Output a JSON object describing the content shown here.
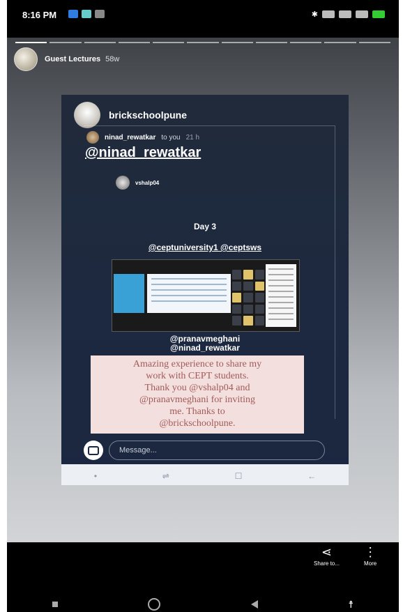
{
  "status_bar": {
    "time": "8:16 PM",
    "right_text": "* ▭ ▭ ▭ ▭ #"
  },
  "story_header": {
    "account": "Guest Lectures",
    "age": "58w"
  },
  "inner_screenshot": {
    "account": "brickschoolpune",
    "reply": {
      "user": "ninad_rewatkar",
      "to_you": "to you",
      "ago": "21 h",
      "mention": "@ninad_rewatkar"
    },
    "shared_story": {
      "user": "vshalp04",
      "day": "Day 3",
      "tags_top": "@ceptuniversity1 @ceptsws",
      "tags_bottom": [
        "@pranavmeghani",
        "@ninad_rewatkar"
      ]
    },
    "quote": {
      "line1": "Amazing experience to share my",
      "line2": "work with CEPT students.",
      "line3": "Thank you @vshalp04  and",
      "line4": "@pranavmeghani  for inviting",
      "line5": "me. Thanks to",
      "line6": "@brickschoolpune."
    },
    "message_placeholder": "Message...",
    "nav": [
      "•",
      "⇌",
      "☐",
      "←"
    ]
  },
  "actions": {
    "share_label": "Share to...",
    "more_label": "More"
  }
}
